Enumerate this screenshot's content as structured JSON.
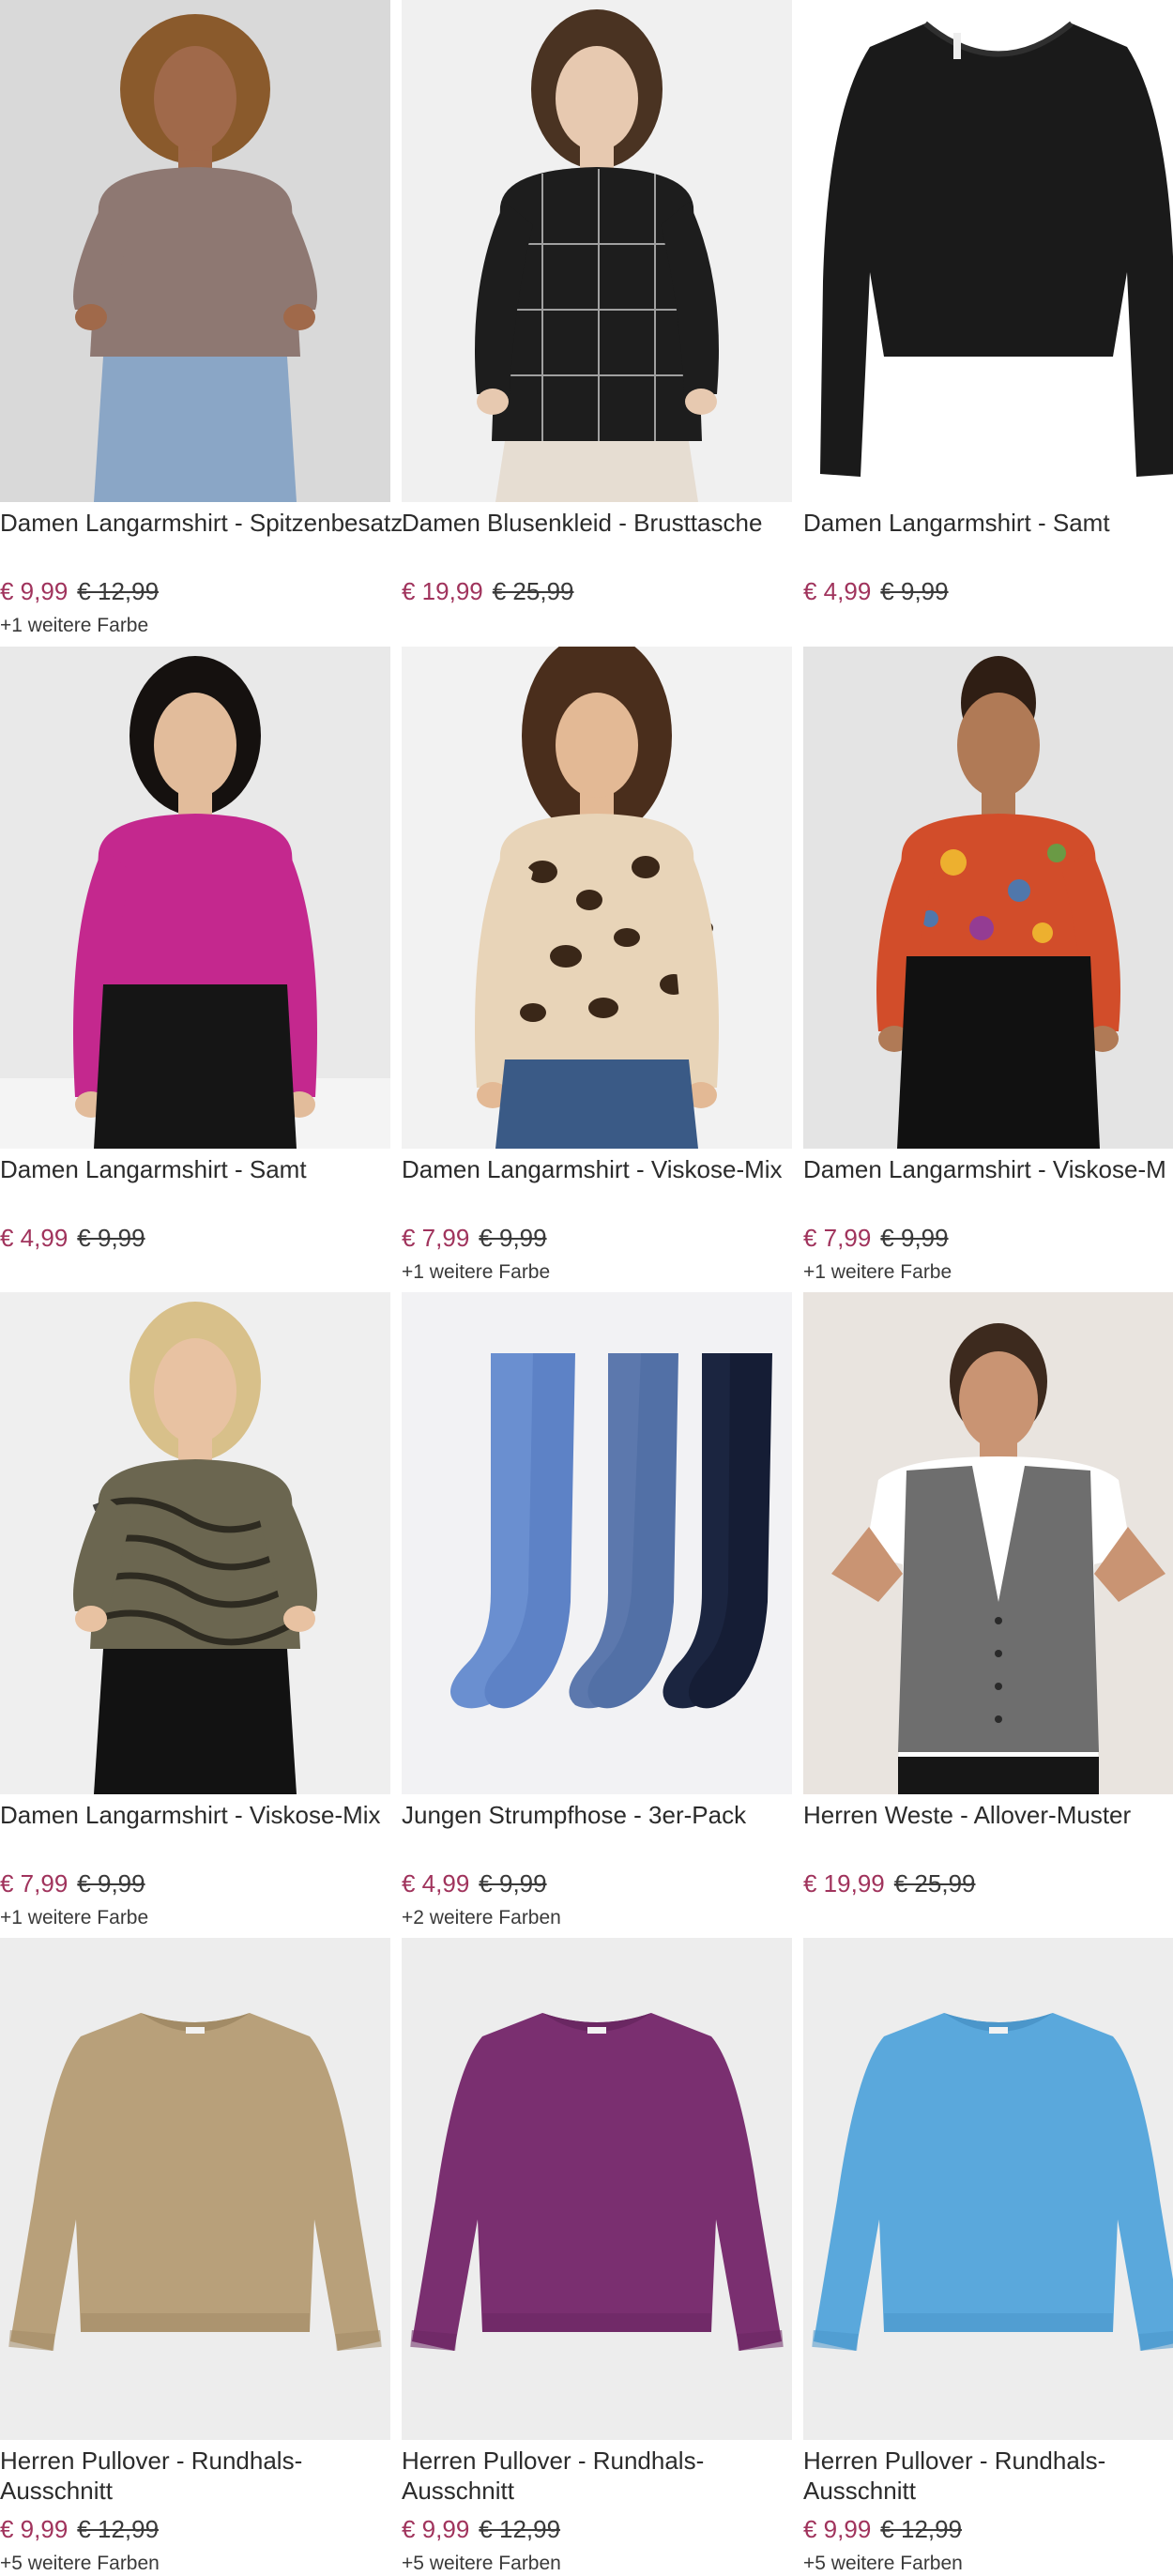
{
  "products": [
    {
      "title": "Damen Langarmshirt - Spitzenbesatz",
      "price": "€ 9,99",
      "old_price": "€ 12,99",
      "colors": "+1 weitere Farbe",
      "image": "woman-mauve-lace-shirt"
    },
    {
      "title": "Damen Blusenkleid - Brusttasche",
      "price": "€ 19,99",
      "old_price": "€ 25,99",
      "colors": "",
      "image": "woman-plaid-shirt-dress"
    },
    {
      "title": "Damen Langarmshirt - Samt",
      "price": "€ 4,99",
      "old_price": "€ 9,99",
      "colors": "",
      "image": "black-velvet-shirt"
    },
    {
      "title": "Damen Langarmshirt - Samt",
      "price": "€ 4,99",
      "old_price": "€ 9,99",
      "colors": "",
      "image": "woman-pink-velvet-shirt"
    },
    {
      "title": "Damen Langarmshirt - Viskose-Mix",
      "price": "€ 7,99",
      "old_price": "€ 9,99",
      "colors": "+1 weitere Farbe",
      "image": "woman-leopard-shirt"
    },
    {
      "title": "Damen Langarmshirt - Viskose-M",
      "price": "€ 7,99",
      "old_price": "€ 9,99",
      "colors": "+1 weitere Farbe",
      "image": "woman-paisley-shirt"
    },
    {
      "title": "Damen Langarmshirt - Viskose-Mix",
      "price": "€ 7,99",
      "old_price": "€ 9,99",
      "colors": "+1 weitere Farbe",
      "image": "woman-wave-pattern-shirt"
    },
    {
      "title": "Jungen Strumpfhose - 3er-Pack",
      "price": "€ 4,99",
      "old_price": "€ 9,99",
      "colors": "+2 weitere Farben",
      "image": "tights-three-pack"
    },
    {
      "title": "Herren Weste - Allover-Muster",
      "price": "€ 19,99",
      "old_price": "€ 25,99",
      "colors": "",
      "image": "man-grey-vest"
    },
    {
      "title": "Herren Pullover - Rundhals-Ausschnitt",
      "price": "€ 9,99",
      "old_price": "€ 12,99",
      "colors": "+5 weitere Farben",
      "image": "beige-sweater"
    },
    {
      "title": "Herren Pullover - Rundhals-Ausschnitt",
      "price": "€ 9,99",
      "old_price": "€ 12,99",
      "colors": "+5 weitere Farben",
      "image": "purple-sweater"
    },
    {
      "title": "Herren Pullover - Rundhals-Ausschnitt",
      "price": "€ 9,99",
      "old_price": "€ 12,99",
      "colors": "+5 weitere Farben",
      "image": "blue-sweater"
    }
  ],
  "colors": {
    "sale_price": "#a0335c",
    "text": "#2b2b2b"
  }
}
